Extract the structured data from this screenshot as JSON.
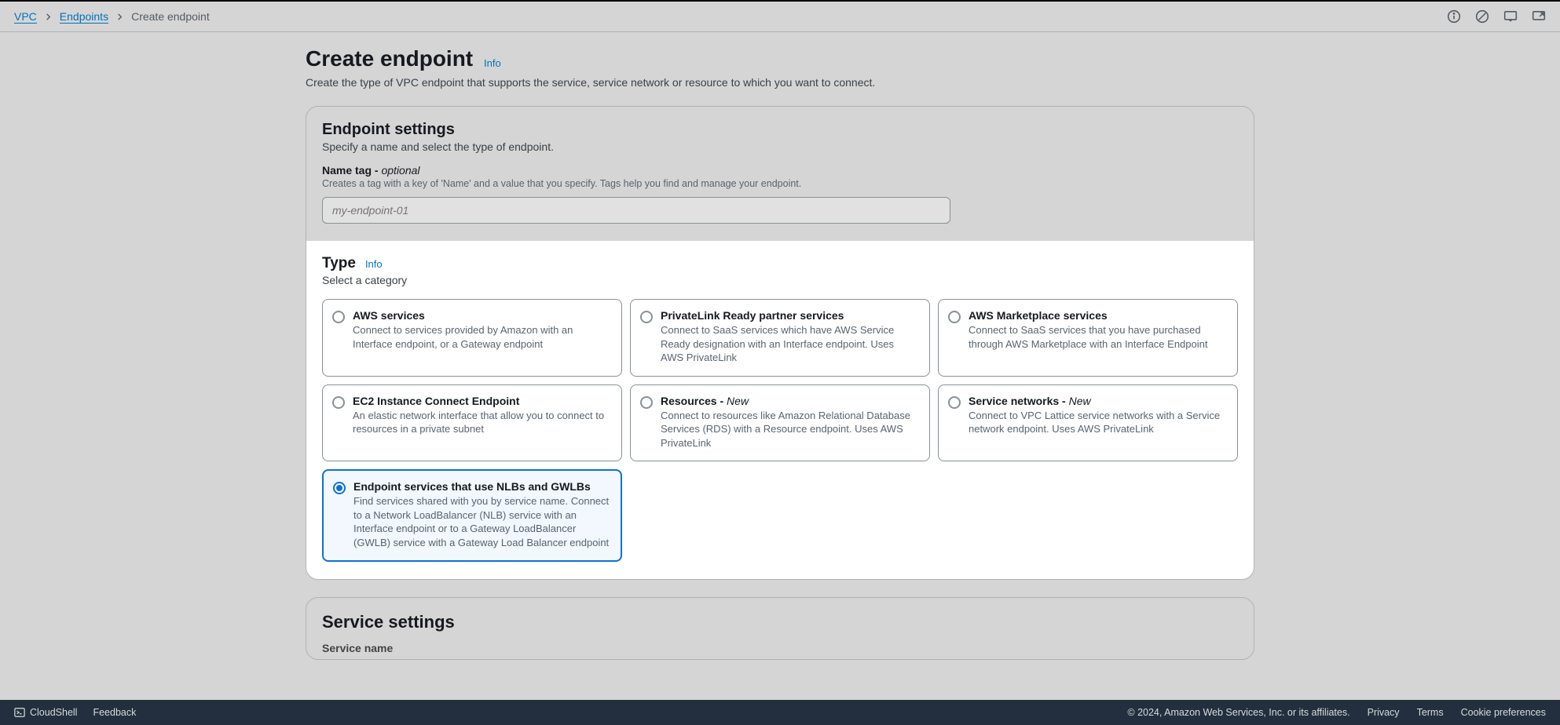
{
  "breadcrumb": {
    "items": [
      "VPC",
      "Endpoints",
      "Create endpoint"
    ]
  },
  "page": {
    "title": "Create endpoint",
    "info": "Info",
    "description": "Create the type of VPC endpoint that supports the service, service network or resource to which you want to connect."
  },
  "settings": {
    "heading": "Endpoint settings",
    "sub": "Specify a name and select the type of endpoint.",
    "name_label": "Name tag - ",
    "name_optional": "optional",
    "name_help": "Creates a tag with a key of 'Name' and a value that you specify. Tags help you find and manage your endpoint.",
    "name_placeholder": "my-endpoint-01"
  },
  "type": {
    "heading": "Type",
    "info": "Info",
    "sub": "Select a category",
    "options": [
      {
        "title": "AWS services",
        "new": false,
        "desc": "Connect to services provided by Amazon with an Interface endpoint, or a Gateway endpoint",
        "selected": false
      },
      {
        "title": "PrivateLink Ready partner services",
        "new": false,
        "desc": "Connect to SaaS services which have AWS Service Ready designation with an Interface endpoint. Uses AWS PrivateLink",
        "selected": false
      },
      {
        "title": "AWS Marketplace services",
        "new": false,
        "desc": "Connect to SaaS services that you have purchased through AWS Marketplace with an Interface Endpoint",
        "selected": false
      },
      {
        "title": "EC2 Instance Connect Endpoint",
        "new": false,
        "desc": "An elastic network interface that allow you to connect to resources in a private subnet",
        "selected": false
      },
      {
        "title": "Resources - ",
        "new": true,
        "desc": "Connect to resources like Amazon Relational Database Services (RDS) with a Resource endpoint. Uses AWS PrivateLink",
        "selected": false
      },
      {
        "title": "Service networks - ",
        "new": true,
        "desc": "Connect to VPC Lattice service networks with a Service network endpoint. Uses AWS PrivateLink",
        "selected": false
      },
      {
        "title": "Endpoint services that use NLBs and GWLBs",
        "new": false,
        "desc": "Find services shared with you by service name. Connect to a Network LoadBalancer (NLB) service with an Interface endpoint or to a Gateway LoadBalancer (GWLB) service with a Gateway Load Balancer endpoint",
        "selected": true
      }
    ],
    "new_label": "New"
  },
  "service_settings": {
    "heading": "Service settings",
    "name_label": "Service name"
  },
  "footer": {
    "cloudshell": "CloudShell",
    "feedback": "Feedback",
    "copyright": "© 2024, Amazon Web Services, Inc. or its affiliates.",
    "privacy": "Privacy",
    "terms": "Terms",
    "cookies": "Cookie preferences"
  }
}
